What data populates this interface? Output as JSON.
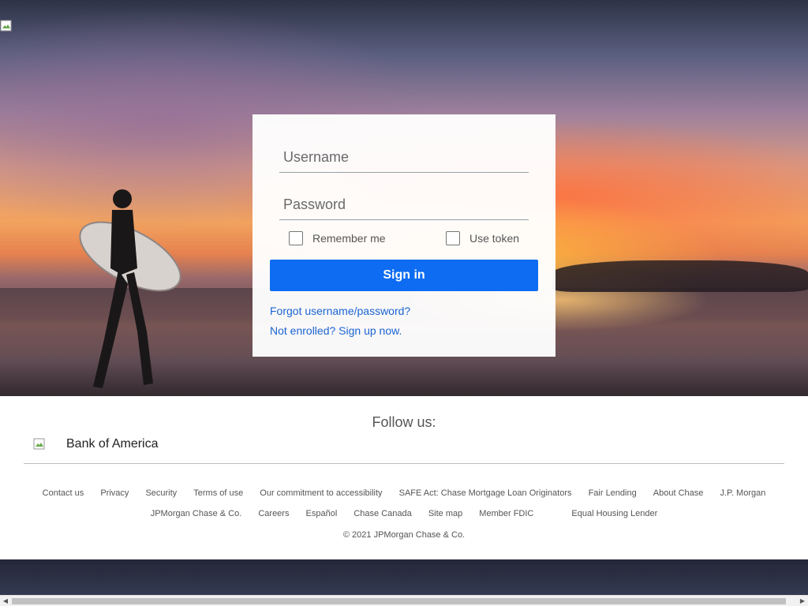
{
  "login": {
    "username_placeholder": "Username",
    "password_placeholder": "Password",
    "remember_label": "Remember me",
    "token_label": "Use token",
    "signin_label": "Sign in",
    "forgot_link": "Forgot username/password?",
    "enroll_link": "Not enrolled? Sign up now."
  },
  "footer": {
    "follow_label": "Follow us:",
    "social_alt": "Bank of America",
    "links_row1": [
      "Contact us",
      "Privacy",
      "Security",
      "Terms of use",
      "Our commitment to accessibility",
      "SAFE Act: Chase Mortgage Loan Originators",
      "Fair Lending",
      "About Chase",
      "J.P. Morgan"
    ],
    "links_row2": [
      "JPMorgan Chase & Co.",
      "Careers",
      "Español",
      "Chase Canada",
      "Site map",
      "Member FDIC",
      "Equal Housing Lender"
    ],
    "copyright": "© 2021 JPMorgan Chase & Co."
  },
  "colors": {
    "primary_button": "#0d6cf2",
    "link": "#1a64d2"
  },
  "icons": {
    "broken_image": "broken-image-icon",
    "scroll_left": "scroll-left-arrow-icon",
    "scroll_right": "scroll-right-arrow-icon"
  }
}
